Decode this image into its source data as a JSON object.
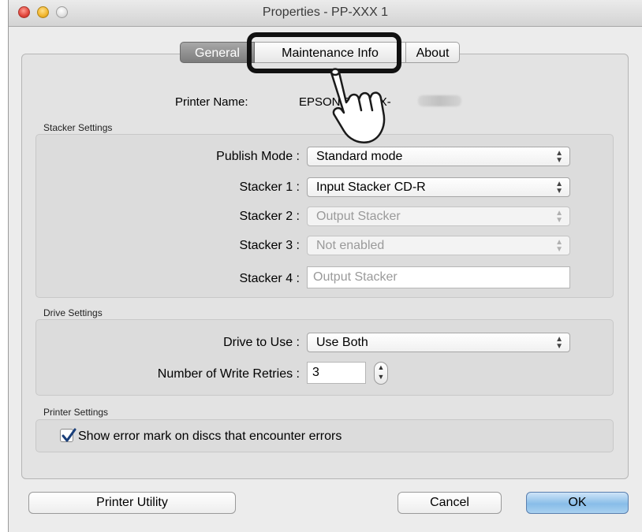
{
  "window": {
    "title": "Properties - PP-XXX 1"
  },
  "tabs": [
    {
      "label": "General",
      "selected": true
    },
    {
      "label": "Maintenance Info",
      "selected": false
    },
    {
      "label": "About",
      "selected": false
    }
  ],
  "printer": {
    "name_label": "Printer Name:",
    "name_value": "EPSON PP-XXX-"
  },
  "stacker_settings": {
    "title": "Stacker Settings",
    "rows": [
      {
        "label": "Publish Mode",
        "value": "Standard mode",
        "enabled": true
      },
      {
        "label": "Stacker 1",
        "value": "Input Stacker CD-R",
        "enabled": true
      },
      {
        "label": "Stacker 2",
        "value": "Output Stacker",
        "enabled": false
      },
      {
        "label": "Stacker 3",
        "value": "Not enabled",
        "enabled": false
      },
      {
        "label": "Stacker 4",
        "value": "Output Stacker",
        "enabled": false
      }
    ]
  },
  "drive_settings": {
    "title": "Drive Settings",
    "drive_label": "Drive to Use",
    "drive_value": "Use Both",
    "retries_label": "Number of Write Retries",
    "retries_value": "3"
  },
  "printer_settings": {
    "title": "Printer Settings",
    "error_mark_label": "Show error mark on discs that encounter errors",
    "error_mark_checked": true
  },
  "buttons": {
    "utility": "Printer Utility",
    "cancel": "Cancel",
    "ok": "OK"
  },
  "separator": ":",
  "colors": {
    "ok_button": "#88bde8",
    "callout": "#111111"
  }
}
